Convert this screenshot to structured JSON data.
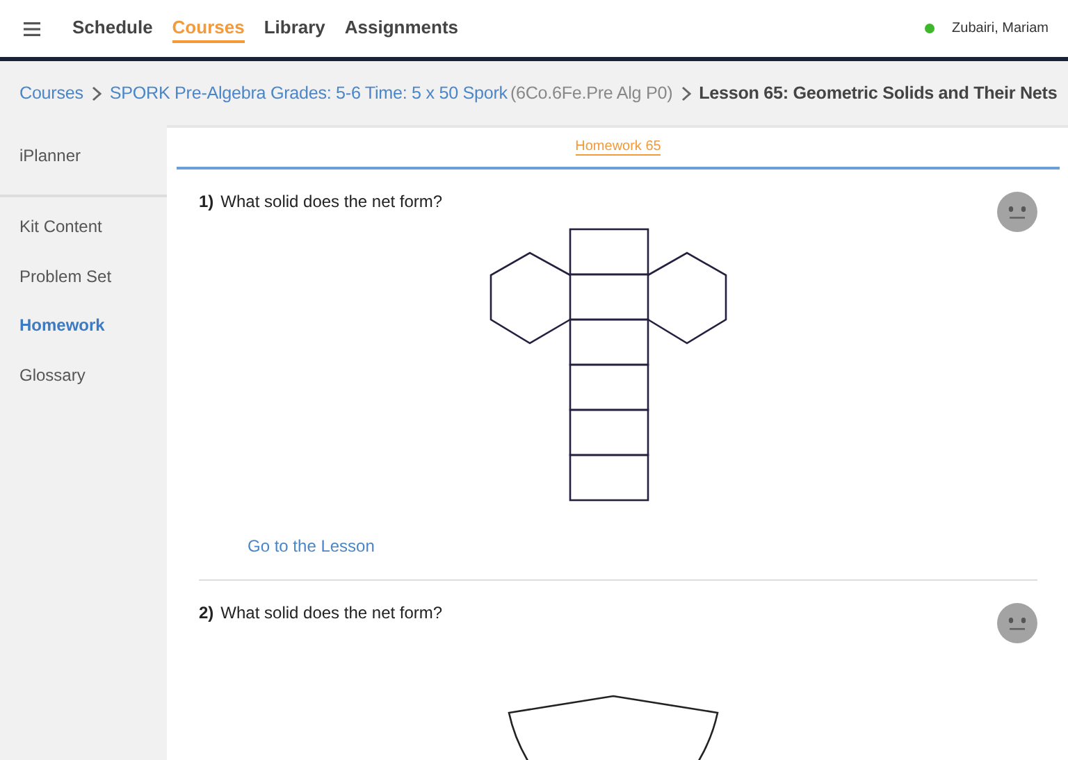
{
  "nav": [
    {
      "label": "Schedule",
      "selected": false
    },
    {
      "label": "Courses",
      "selected": true
    },
    {
      "label": "Library",
      "selected": false
    },
    {
      "label": "Assignments",
      "selected": false
    }
  ],
  "user": {
    "name": "Zubairi, Mariam",
    "online": true
  },
  "breadcrumb": [
    {
      "label": "Courses",
      "kind": "link"
    },
    {
      "label": "SPORK Pre-Algebra Grades: 5-6 Time: 5 x 50 Spork",
      "kind": "link",
      "note": "(6Co.6Fe.Pre Alg P0)"
    },
    {
      "label": "Lesson 65: Geometric Solids and Their Nets",
      "kind": "current"
    }
  ],
  "sidebar": {
    "planner": {
      "label": "iPlanner",
      "selected": false
    },
    "items": [
      {
        "label": "Kit Content",
        "selected": false
      },
      {
        "label": "Problem Set",
        "selected": false
      },
      {
        "label": "Homework",
        "selected": true
      },
      {
        "label": "Glossary",
        "selected": false
      }
    ]
  },
  "tabs": [
    {
      "label": "Homework 65",
      "selected": true
    }
  ],
  "questions": [
    {
      "number": "1)",
      "text": "What solid does the net form?",
      "kind": "hexagonal-prism-net",
      "link": "Go to the Lesson"
    },
    {
      "number": "2)",
      "text": "What solid does the net form?",
      "kind": "curved-net"
    }
  ]
}
